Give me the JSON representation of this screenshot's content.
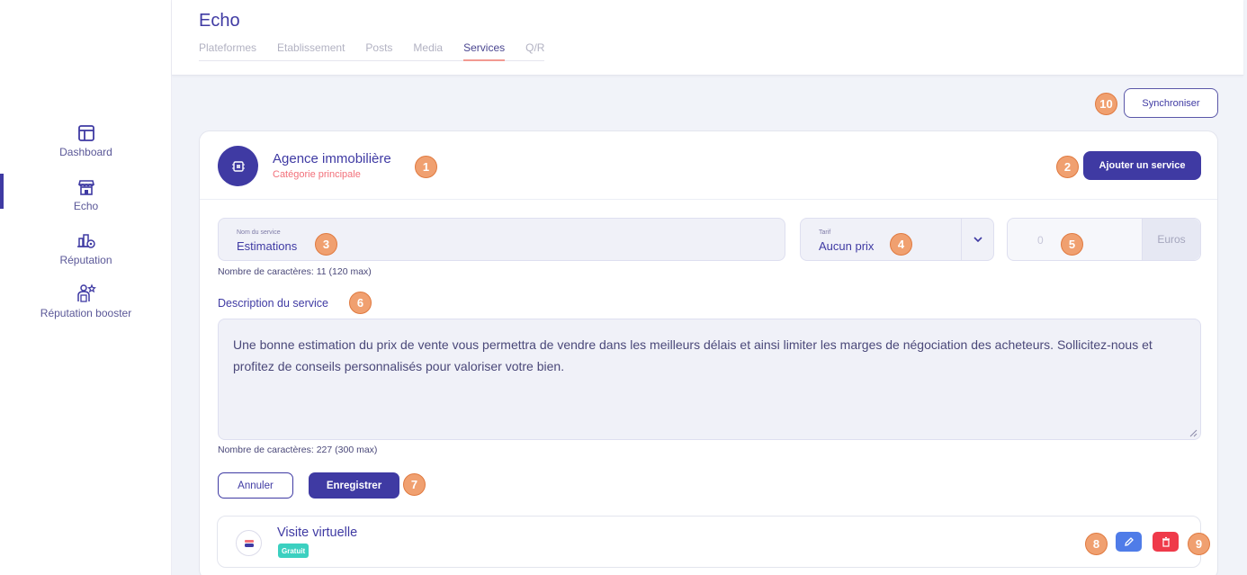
{
  "sidebar": {
    "items": [
      {
        "label": "Dashboard",
        "icon": "dashboard-icon"
      },
      {
        "label": "Echo",
        "icon": "store-icon",
        "active": true
      },
      {
        "label": "Réputation",
        "icon": "reputation-icon"
      },
      {
        "label": "Réputation booster",
        "icon": "reputation-booster-icon"
      }
    ]
  },
  "header": {
    "title": "Echo",
    "tabs": [
      {
        "label": "Plateformes"
      },
      {
        "label": "Etablissement"
      },
      {
        "label": "Posts"
      },
      {
        "label": "Media"
      },
      {
        "label": "Services",
        "active": true
      },
      {
        "label": "Q/R"
      }
    ]
  },
  "sync_button": "Synchroniser",
  "category": {
    "title": "Agence immobilière",
    "subtitle": "Catégorie principale",
    "add_button": "Ajouter un service"
  },
  "form": {
    "name_label": "Nom du service",
    "name_value": "Estimations",
    "name_count": "Nombre de caractères: 11 (120 max)",
    "tarif_label": "Tarif",
    "tarif_value": "Aucun prix",
    "price_value": "0",
    "price_unit": "Euros",
    "description_label": "Description du service",
    "description_value": "Une bonne estimation du prix de vente vous permettra de vendre dans les meilleurs délais et ainsi limiter les marges de négociation des acheteurs. Sollicitez-nous et profitez de conseils personnalisés pour valoriser votre bien.",
    "description_count": "Nombre de caractères: 227 (300 max)",
    "cancel_button": "Annuler",
    "save_button": "Enregistrer"
  },
  "services": [
    {
      "name": "Visite virtuelle",
      "tag": "Gratuit"
    }
  ],
  "annotations": [
    "1",
    "2",
    "3",
    "4",
    "5",
    "6",
    "7",
    "8",
    "9",
    "10"
  ],
  "colors": {
    "primary": "#3f3aa3",
    "accent_red": "#f2707a",
    "edit_blue": "#4f7ce8",
    "delete_red": "#ef3a4a",
    "tag_teal": "#3bd0c0",
    "badge_orange": "#f0a070"
  }
}
